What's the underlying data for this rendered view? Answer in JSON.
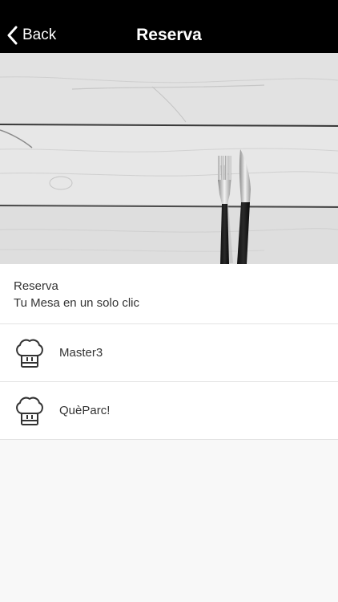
{
  "navbar": {
    "back_label": "Back",
    "title": "Reserva"
  },
  "intro": {
    "title": "Reserva",
    "subtitle": "Tu Mesa en un solo clic"
  },
  "restaurants": [
    {
      "name": "Master3",
      "icon": "chef-hat-icon"
    },
    {
      "name": "QuèParc!",
      "icon": "chef-hat-icon"
    }
  ],
  "colors": {
    "navbar_bg": "#000000",
    "navbar_text": "#ffffff",
    "body_bg": "#f8f8f8",
    "divider": "#e3e3e3"
  }
}
